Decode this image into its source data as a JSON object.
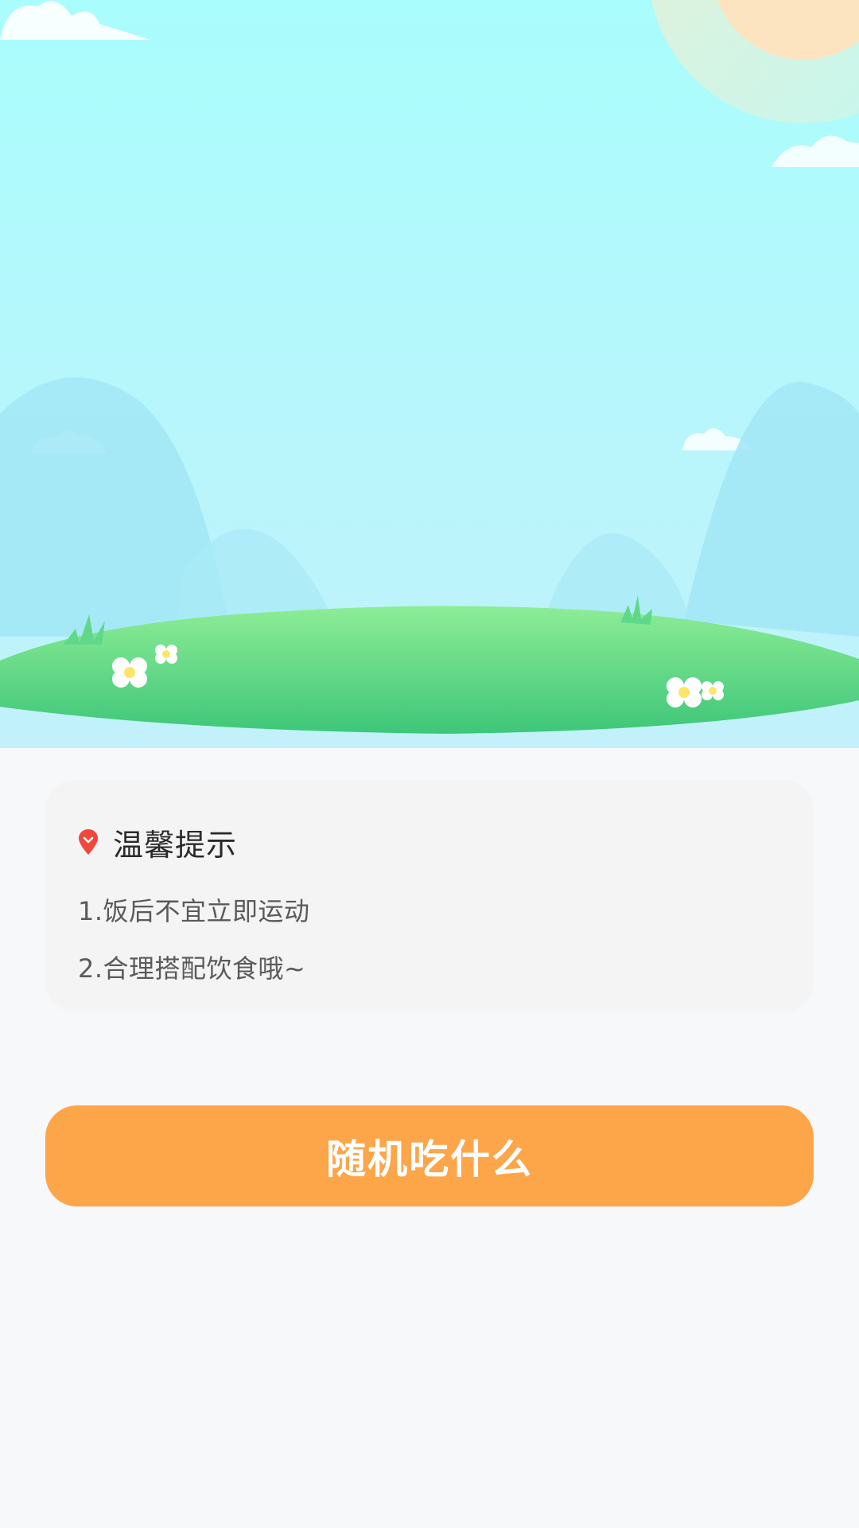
{
  "tips": {
    "title": "温馨提示",
    "icon": "location-pin-icon",
    "items": [
      "1.饭后不宜立即运动",
      "2.合理搭配饮食哦~"
    ]
  },
  "action_button": {
    "label": "随机吃什么"
  },
  "colors": {
    "accent": "#fda549",
    "sky_top": "#a9fdfc",
    "sky_bottom": "#bdf2fb",
    "grass": "#4fd27e",
    "background": "#f7f8fa",
    "card": "#f4f4f5",
    "pin": "#f0483c"
  }
}
